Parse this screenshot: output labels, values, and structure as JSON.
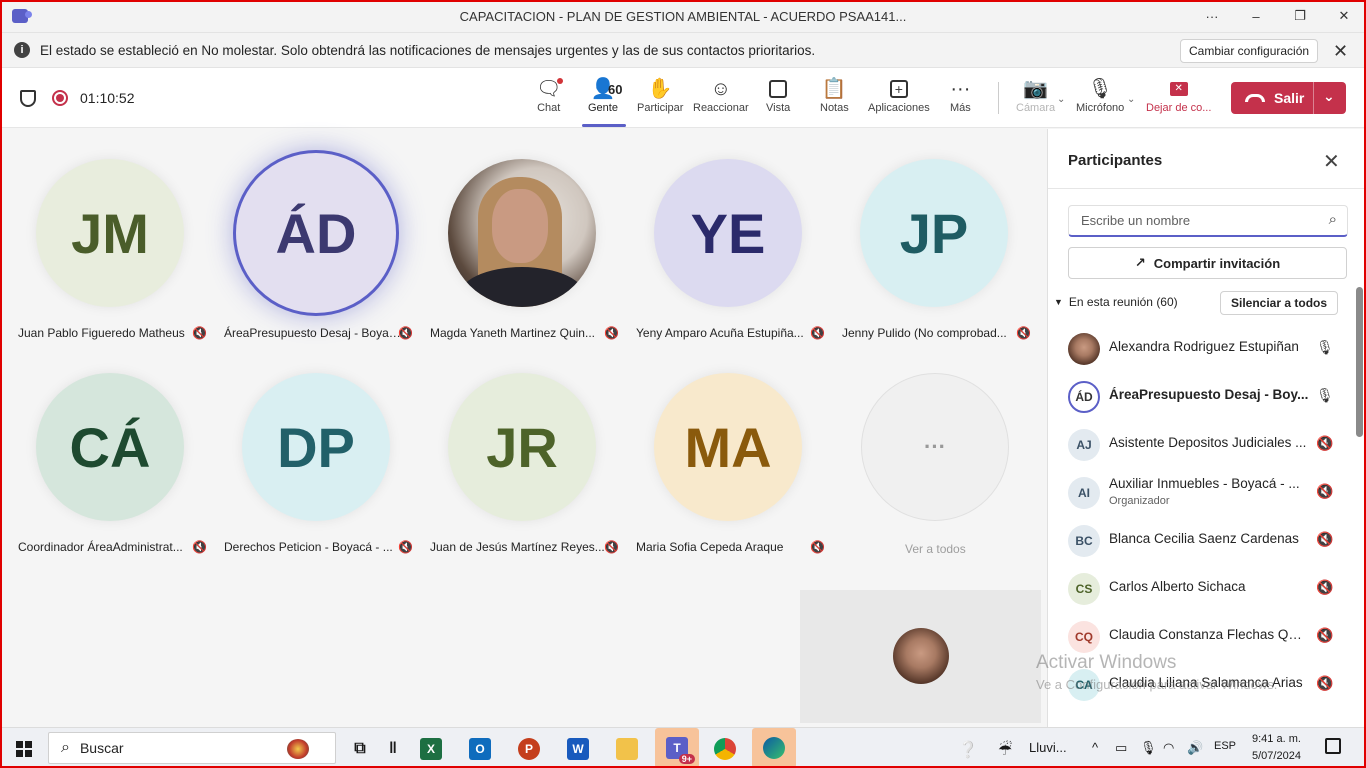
{
  "window": {
    "title": "CAPACITACION - PLAN DE GESTION AMBIENTAL - ACUERDO PSAA141...",
    "controls": [
      "···",
      "–",
      "❐",
      "✕"
    ]
  },
  "notice": {
    "text": "El estado se estableció en No molestar. Solo obtendrá las notificaciones de mensajes urgentes y las de sus contactos prioritarios.",
    "button": "Cambiar configuración"
  },
  "toolbar": {
    "timer": "01:10:52",
    "people_count": "60",
    "items": {
      "chat": "Chat",
      "people": "Gente",
      "raise": "Participar",
      "react": "Reaccionar",
      "view": "Vista",
      "notes": "Notas",
      "apps": "Aplicaciones",
      "more": "Más",
      "camera": "Cámara",
      "mic": "Micrófono",
      "share": "Dejar de co..."
    },
    "leave": "Salir"
  },
  "stage": {
    "tiles": [
      {
        "initials": "JM",
        "name": "Juan Pablo Figueredo Matheus",
        "bg": "#e8eddd",
        "fg": "#4a5d2a"
      },
      {
        "initials": "ÁD",
        "name": "ÁreaPresupuesto Desaj - Boyacá -...",
        "bg": "#e3dff0",
        "fg": "#3c3970"
      },
      {
        "initials": "",
        "name": "Magda Yaneth Martinez Quin...",
        "bg": "",
        "fg": ""
      },
      {
        "initials": "YE",
        "name": "Yeny Amparo Acuña Estupiña...",
        "bg": "#dcdaf0",
        "fg": "#2b2a6b"
      },
      {
        "initials": "JP",
        "name": "Jenny Pulido (No comprobad...",
        "bg": "#d8eff2",
        "fg": "#1f5c63"
      },
      {
        "initials": "CÁ",
        "name": "Coordinador ÁreaAdministrat...",
        "bg": "#d5e6dc",
        "fg": "#1e4a30"
      },
      {
        "initials": "DP",
        "name": "Derechos Peticion - Boyacá - ...",
        "bg": "#d9eff2",
        "fg": "#226069"
      },
      {
        "initials": "JR",
        "name": "Juan de Jesús Martínez Reyes...",
        "bg": "#e6eddc",
        "fg": "#4d6329"
      },
      {
        "initials": "MA",
        "name": "Maria Sofia Cepeda Araque",
        "bg": "#f8e9cc",
        "fg": "#8a5a0c"
      }
    ],
    "more_label": "Ver a todos",
    "more_glyph": "···"
  },
  "panel": {
    "title": "Participantes",
    "search_placeholder": "Escribe un nombre",
    "share_invite": "Compartir invitación",
    "section": "En esta reunión (60)",
    "mute_all": "Silenciar a todos",
    "participants": [
      {
        "initials": "",
        "name": "Alexandra Rodriguez Estupiñan",
        "role": "",
        "mic": "🎙",
        "bg": "",
        "fg": ""
      },
      {
        "initials": "ÁD",
        "name": "ÁreaPresupuesto Desaj - Boy...",
        "role": "",
        "mic": "🎙",
        "bg": "",
        "fg": ""
      },
      {
        "initials": "AJ",
        "name": "Asistente Depositos Judiciales ...",
        "role": "",
        "mic": "🔇",
        "bg": "#e3eaf0",
        "fg": "#3b5166"
      },
      {
        "initials": "AI",
        "name": "Auxiliar Inmuebles - Boyacá - ...",
        "role": "Organizador",
        "mic": "🔇",
        "bg": "#e3eaf0",
        "fg": "#3b5166"
      },
      {
        "initials": "BC",
        "name": "Blanca Cecilia Saenz Cardenas",
        "role": "",
        "mic": "🔇",
        "bg": "#e3eaf0",
        "fg": "#3b5166"
      },
      {
        "initials": "CS",
        "name": "Carlos Alberto Sichaca",
        "role": "",
        "mic": "🔇",
        "bg": "#e6eddc",
        "fg": "#4d6329"
      },
      {
        "initials": "CQ",
        "name": "Claudia Constanza Flechas Qui...",
        "role": "",
        "mic": "🔇",
        "bg": "#fbe3e0",
        "fg": "#a03a2c"
      },
      {
        "initials": "CA",
        "name": "Claudia Liliana Salamanca Arias",
        "role": "",
        "mic": "🔇",
        "bg": "#d8eff2",
        "fg": "#226069"
      }
    ]
  },
  "watermark": {
    "title": "Activar Windows",
    "subtitle": "Ve a Configuración para activar Windows."
  },
  "taskbar": {
    "search": "Buscar",
    "weather": "Lluvi...",
    "lang": "ESP",
    "time": "9:41 a. m.",
    "date": "5/07/2024",
    "teams_badge": "9+"
  }
}
